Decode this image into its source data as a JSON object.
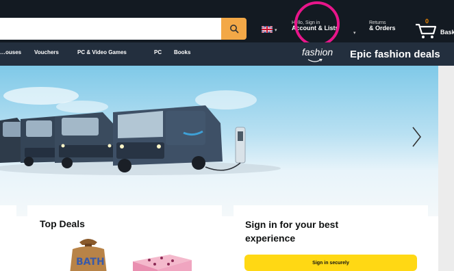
{
  "header": {
    "search": {
      "value": "",
      "placeholder": ""
    },
    "language": {
      "flag_icon": "uk-flag-icon"
    },
    "account": {
      "line1": "Hello, Sign in",
      "line2": "Account & Lists"
    },
    "orders": {
      "line1": "Returns",
      "line2": "& Orders"
    },
    "basket": {
      "count": "0",
      "label": "Bask"
    }
  },
  "subnav": {
    "items": [
      "…ouses",
      "Vouchers",
      "PC & Video Games",
      "PC",
      "Books"
    ],
    "promo": {
      "logo": "fashion",
      "text": "Epic fashion deals"
    }
  },
  "cards": {
    "deals": {
      "title": "Top Deals"
    },
    "signin": {
      "title": "Sign in for your best experience",
      "button": "Sign in securely"
    }
  },
  "colors": {
    "nav_dark": "#131a22",
    "nav_sub": "#232f3e",
    "search_button": "#f3a847",
    "signin_button": "#ffd814",
    "highlight": "#e8158a"
  }
}
